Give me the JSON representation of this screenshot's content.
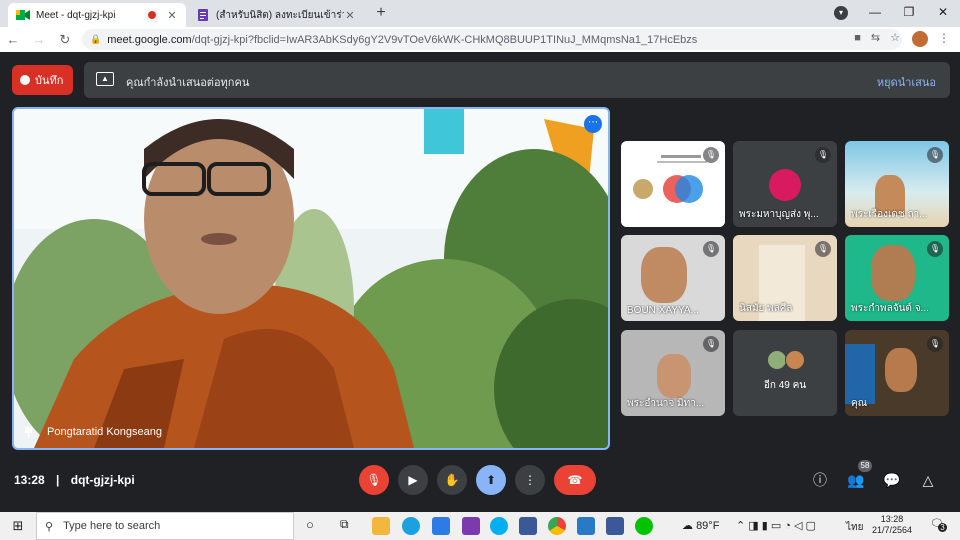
{
  "browser": {
    "tabs": [
      {
        "title": "Meet - dqt-gjzj-kpi",
        "active": true
      },
      {
        "title": "(สำหรับนิสิต) ลงทะเบียนเข้าร่วมกิจกรรม",
        "active": false
      }
    ],
    "new_tab": "+",
    "window_controls": {
      "minimize": "—",
      "restore": "❐",
      "close": "✕"
    },
    "url_host": "meet.google.com",
    "url_path": "/dqt-gjzj-kpi?fbclid=IwAR3AbKSdy6gY2V9vTOeV6kWK-CHkMQ8BUUP1TINuJ_MMqmsNa1_17HcEbzs"
  },
  "meet": {
    "record_label": "บันทึก",
    "presenting_text": "คุณกำลังนำเสนอต่อทุกคน",
    "stop_presenting": "หยุดนำเสนอ",
    "main_speaker": "Pongtaratid Kongseang",
    "tiles": [
      {
        "name": "",
        "kind": "slide"
      },
      {
        "name": "พระมหาบุญส่ง พุ...",
        "kind": "avatar"
      },
      {
        "name": "พระเรืองเดช ถา...",
        "kind": "video"
      },
      {
        "name": "BOUN XAYYA...",
        "kind": "video"
      },
      {
        "name": "นิสมัย พลศีล",
        "kind": "video"
      },
      {
        "name": "พระกำพลจันต์ จ...",
        "kind": "video"
      },
      {
        "name": "พระอำนาจ มิทา...",
        "kind": "video"
      },
      {
        "name": "อีก 49 คน",
        "kind": "others"
      },
      {
        "name": "คุณ",
        "kind": "video"
      }
    ],
    "meeting_time": "13:28",
    "meeting_code": "dqt-gjzj-kpi",
    "participants_count": "58"
  },
  "taskbar": {
    "search_placeholder": "Type here to search",
    "temperature": "89°F",
    "language": "ไทย",
    "clock_time": "13:28",
    "clock_date": "21/7/2564",
    "notification_count": "3"
  },
  "colors": {
    "meet_bg": "#202124",
    "record_red": "#d93025",
    "accent_blue": "#8ab4f8",
    "end_call_red": "#ea4335"
  }
}
